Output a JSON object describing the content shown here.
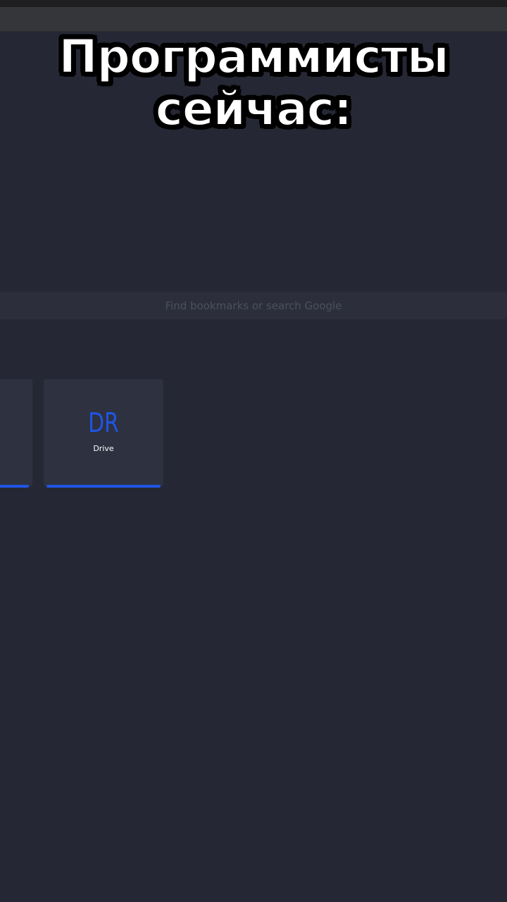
{
  "caption": {
    "line1": "Программисты",
    "line2": "сейчас:"
  },
  "search": {
    "placeholder": "Find bookmarks or search Google"
  },
  "bookmarks": [
    {
      "abbr": "",
      "label": ""
    },
    {
      "abbr": "DR",
      "label": "Drive"
    }
  ],
  "colors": {
    "background": "#252834",
    "tile": "#2e3140",
    "accent": "#1f55e6",
    "search_bg": "#2c2f3b"
  }
}
